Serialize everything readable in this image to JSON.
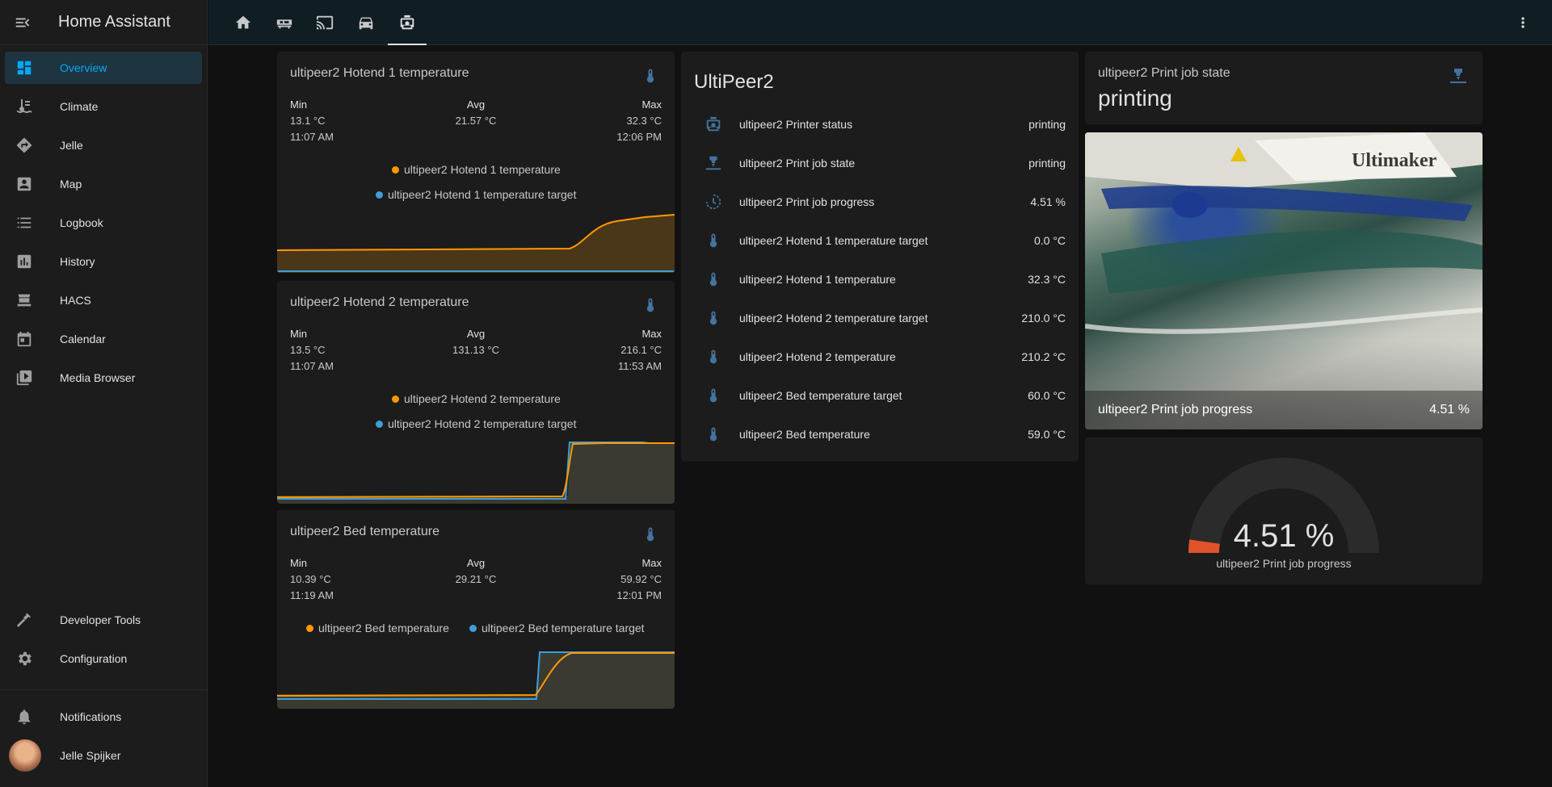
{
  "app": {
    "title": "Home Assistant"
  },
  "sidebar": {
    "items": [
      {
        "label": "Overview",
        "icon": "dashboard-icon",
        "active": true
      },
      {
        "label": "Climate",
        "icon": "climate-icon"
      },
      {
        "label": "Jelle",
        "icon": "directions-icon"
      },
      {
        "label": "Map",
        "icon": "map-account-icon"
      },
      {
        "label": "Logbook",
        "icon": "logbook-icon"
      },
      {
        "label": "History",
        "icon": "history-chart-icon"
      },
      {
        "label": "HACS",
        "icon": "hacs-icon"
      },
      {
        "label": "Calendar",
        "icon": "calendar-icon"
      },
      {
        "label": "Media Browser",
        "icon": "media-browser-icon"
      }
    ],
    "bottom_items": [
      {
        "label": "Developer Tools",
        "icon": "hammer-icon"
      },
      {
        "label": "Configuration",
        "icon": "gear-icon"
      }
    ],
    "notifications": "Notifications",
    "user": "Jelle Spijker"
  },
  "topbar": {
    "tabs": [
      "home-icon",
      "bed-icon",
      "cast-icon",
      "car-icon",
      "printer-3d-icon"
    ],
    "active_tab": 4
  },
  "history_cards": [
    {
      "title": "ultipeer2 Hotend 1 temperature",
      "min_label": "Min",
      "min_value": "13.1 °C",
      "min_time": "11:07 AM",
      "avg_label": "Avg",
      "avg_value": "21.57 °C",
      "max_label": "Max",
      "max_value": "32.3 °C",
      "max_time": "12:06 PM",
      "legend": [
        "ultipeer2 Hotend 1 temperature",
        "ultipeer2 Hotend 1 temperature target"
      ]
    },
    {
      "title": "ultipeer2 Hotend 2 temperature",
      "min_label": "Min",
      "min_value": "13.5 °C",
      "min_time": "11:07 AM",
      "avg_label": "Avg",
      "avg_value": "131.13 °C",
      "max_label": "Max",
      "max_value": "216.1 °C",
      "max_time": "11:53 AM",
      "legend": [
        "ultipeer2 Hotend 2 temperature",
        "ultipeer2 Hotend 2 temperature target"
      ]
    },
    {
      "title": "ultipeer2 Bed temperature",
      "min_label": "Min",
      "min_value": "10.39 °C",
      "min_time": "11:19 AM",
      "avg_label": "Avg",
      "avg_value": "29.21 °C",
      "max_label": "Max",
      "max_value": "59.92 °C",
      "max_time": "12:01 PM",
      "legend": [
        "ultipeer2 Bed temperature",
        "ultipeer2 Bed temperature target"
      ]
    }
  ],
  "entities_card": {
    "title": "UltiPeer2",
    "rows": [
      {
        "icon": "printer-3d-icon",
        "name": "ultipeer2 Printer status",
        "value": "printing"
      },
      {
        "icon": "printer-nozzle-icon",
        "name": "ultipeer2 Print job state",
        "value": "printing"
      },
      {
        "icon": "progress-clock-icon",
        "name": "ultipeer2 Print job progress",
        "value": "4.51 %"
      },
      {
        "icon": "thermometer-icon",
        "name": "ultipeer2 Hotend 1 temperature target",
        "value": "0.0 °C"
      },
      {
        "icon": "thermometer-icon",
        "name": "ultipeer2 Hotend 1 temperature",
        "value": "32.3 °C"
      },
      {
        "icon": "thermometer-icon",
        "name": "ultipeer2 Hotend 2 temperature target",
        "value": "210.0 °C"
      },
      {
        "icon": "thermometer-icon",
        "name": "ultipeer2 Hotend 2 temperature",
        "value": "210.2 °C"
      },
      {
        "icon": "thermometer-icon",
        "name": "ultipeer2 Bed temperature target",
        "value": "60.0 °C"
      },
      {
        "icon": "thermometer-icon",
        "name": "ultipeer2 Bed temperature",
        "value": "59.0 °C"
      }
    ]
  },
  "state_card": {
    "name": "ultipeer2 Print job state",
    "state": "printing",
    "icon": "printer-nozzle-icon"
  },
  "camera_card": {
    "name": "ultipeer2 Print job progress",
    "value": "4.51 %",
    "image": "ultimaker-printer-camera-view",
    "brand_text": "Ultimaker"
  },
  "gauge_card": {
    "value": "4.51 %",
    "fraction": 0.0451,
    "name": "ultipeer2 Print job progress"
  },
  "colors": {
    "accent": "#03a9f4",
    "series_current": "#ff9800",
    "series_target": "#3d9fd9",
    "gauge_fill": "#e0532a",
    "icon_blue": "#44739e"
  }
}
